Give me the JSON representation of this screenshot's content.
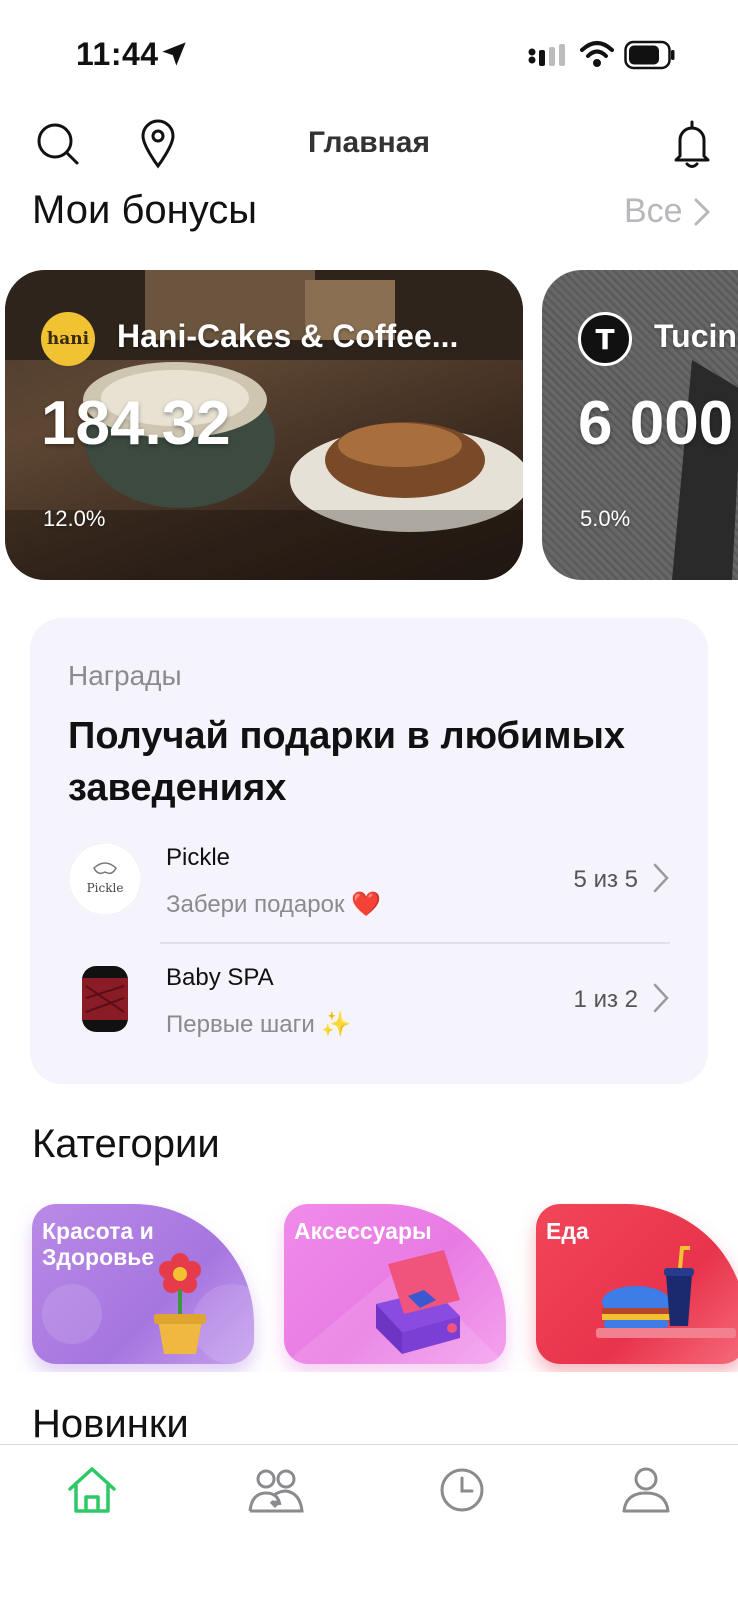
{
  "status_bar": {
    "time": "11:44"
  },
  "top_nav": {
    "title": "Главная",
    "icons": [
      "search-icon",
      "location-pin-icon",
      "bell-icon"
    ]
  },
  "bonuses": {
    "title": "Мои бонусы",
    "all_label": "Все",
    "cards": [
      {
        "logo_text": "hani",
        "name": "Hani-Cakes & Coffee...",
        "value": "184.32",
        "percent": "12.0%"
      },
      {
        "logo_text": "T",
        "name": "Tucin",
        "value": "6 000",
        "percent": "5.0%"
      }
    ]
  },
  "rewards": {
    "eyebrow": "Награды",
    "title": "Получай подарки в любимых заведениях",
    "items": [
      {
        "name": "Pickle",
        "subtitle": "Забери подарок ❤️",
        "progress": "5 из 5",
        "logo_text": "Pickle"
      },
      {
        "name": "Baby SPA",
        "subtitle": "Первые шаги ✨",
        "progress": "1 из 2"
      }
    ]
  },
  "categories": {
    "title": "Категории",
    "items": [
      {
        "label": "Красота и Здоровье",
        "color": "#a676e0"
      },
      {
        "label": "Аксессуары",
        "color": "#e87be3"
      },
      {
        "label": "Еда",
        "color": "#e8344c"
      }
    ]
  },
  "news": {
    "title": "Новинки"
  },
  "tab_bar": {
    "active_color": "#2ec866",
    "inactive_color": "#8a8a8f",
    "tabs": [
      "home-icon",
      "friends-icon",
      "history-icon",
      "profile-icon"
    ]
  }
}
